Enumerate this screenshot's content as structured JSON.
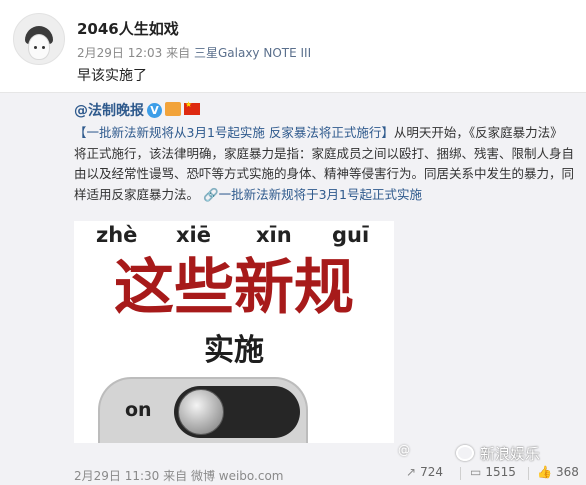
{
  "post": {
    "username": "2046人生如戏",
    "date": "2月29日 12:03",
    "source_prefix": "来自",
    "device": "三星Galaxy NOTE III",
    "text": "早该实施了"
  },
  "repost": {
    "author": "@法制晚报",
    "headline": "【一批新法新规将从3月1号起实施 反家暴法将正式施行】",
    "body_part1": "从明天开始，",
    "book_title": "《反家庭暴力法》",
    "body_part2": "将正式施行，该法律明确，家庭暴力是指：家庭成员之间以殴打、捆绑、残害、限制人身自由以及经常性谩骂、恐吓等方式实施的身体、精神等侵害行为。同居关系中发生的暴力，同样适用反家庭暴力法。",
    "link_text": "一批新法新规将于3月1号起正式实施",
    "poster": {
      "pinyin": [
        "zhè",
        "xiē",
        "xīn",
        "guī"
      ],
      "title": "这些新规",
      "subtitle": "实施",
      "toggle_label": "on"
    },
    "watermark_small": "@",
    "watermark": "新浪娱乐",
    "footer": {
      "date": "2月29日 11:30",
      "source": "来自 微博 weibo.com",
      "reposts": "724",
      "comments": "1515",
      "likes": "368"
    }
  }
}
